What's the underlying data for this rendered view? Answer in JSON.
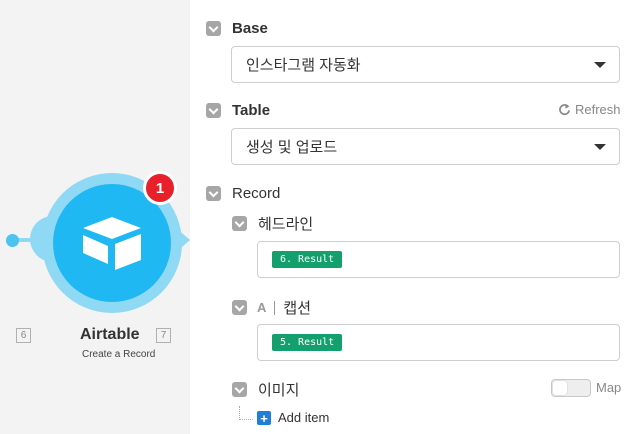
{
  "module": {
    "badge_count": "1",
    "title": "Airtable",
    "subtitle": "Create a Record",
    "prev_index": "6",
    "next_index": "7",
    "brand_color": "#1fb8f2",
    "badge_color": "#e8202a"
  },
  "panel": {
    "base": {
      "label": "Base",
      "value": "인스타그램 자동화"
    },
    "table": {
      "label": "Table",
      "value": "생성 및 업로드",
      "refresh_label": "Refresh"
    },
    "record": {
      "label": "Record",
      "fields": [
        {
          "label": "헤드라인",
          "value": "6. Result"
        },
        {
          "label": "캡션",
          "type_icon": "A",
          "value": "5. Result"
        },
        {
          "label": "이미지",
          "map_label": "Map",
          "map_on": false,
          "add_label": "Add item"
        }
      ]
    },
    "pill_color": "#13a06c"
  }
}
